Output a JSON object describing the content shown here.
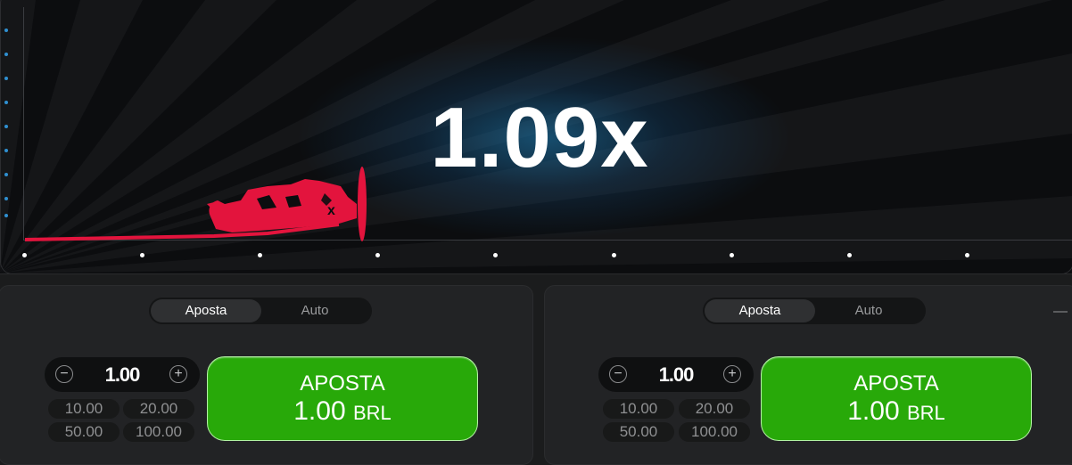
{
  "game": {
    "multiplier": "1.09x"
  },
  "panels": [
    {
      "tabs": [
        "Aposta",
        "Auto"
      ],
      "active_tab": 0,
      "amount": "1.00",
      "quick_amounts": [
        "10.00",
        "20.00",
        "50.00",
        "100.00"
      ],
      "bet_button": {
        "title": "APOSTA",
        "amount": "1.00",
        "currency": "BRL"
      }
    },
    {
      "tabs": [
        "Aposta",
        "Auto"
      ],
      "active_tab": 0,
      "amount": "1.00",
      "quick_amounts": [
        "10.00",
        "20.00",
        "50.00",
        "100.00"
      ],
      "bet_button": {
        "title": "APOSTA",
        "amount": "1.00",
        "currency": "BRL"
      }
    }
  ],
  "icons": {
    "minus": "−",
    "plus": "+"
  },
  "colors": {
    "bet_button": "#28a909",
    "plane": "#e3143d",
    "axis_dots": "#2f8fd0"
  }
}
